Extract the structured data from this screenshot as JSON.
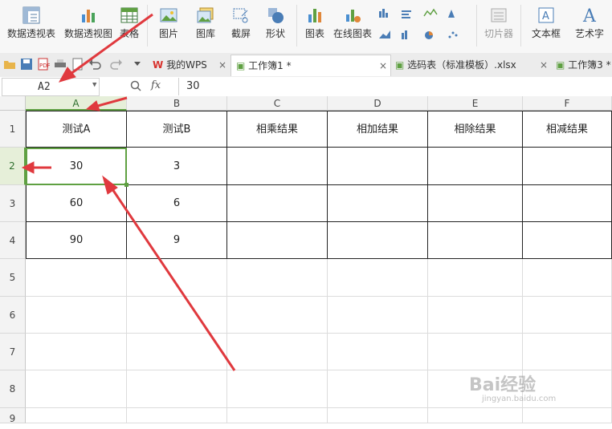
{
  "ribbon": {
    "items": [
      {
        "label": "数据透视表",
        "icon": "pivot-table-icon"
      },
      {
        "label": "数据透视图",
        "icon": "pivot-chart-icon"
      },
      {
        "label": "表格",
        "icon": "table-icon"
      },
      {
        "label": "图片",
        "icon": "picture-icon"
      },
      {
        "label": "图库",
        "icon": "gallery-icon"
      },
      {
        "label": "截屏",
        "icon": "screenshot-icon"
      },
      {
        "label": "形状",
        "icon": "shape-icon"
      },
      {
        "label": "图表",
        "icon": "chart-icon"
      },
      {
        "label": "在线图表",
        "icon": "online-chart-icon"
      },
      {
        "label": "切片器",
        "icon": "slicer-icon"
      },
      {
        "label": "文本框",
        "icon": "textbox-icon"
      },
      {
        "label": "艺术字",
        "icon": "word-art-icon"
      }
    ]
  },
  "tabs": [
    {
      "label": "我的WPS",
      "icon": "wps-logo-icon"
    },
    {
      "label": "工作簿1 *",
      "icon": "sheet-icon",
      "active": true
    },
    {
      "label": "选码表（标准模板）.xlsx",
      "icon": "sheet-icon"
    },
    {
      "label": "工作簿3 *",
      "icon": "sheet-icon"
    }
  ],
  "formula_bar": {
    "name_box": "A2",
    "fx_label": "fx",
    "value": "30"
  },
  "columns": [
    "A",
    "B",
    "C",
    "D",
    "E",
    "F"
  ],
  "rows": [
    "1",
    "2",
    "3",
    "4",
    "5",
    "6",
    "7",
    "8",
    "9"
  ],
  "cells": {
    "r1": [
      "测试A",
      "测试B",
      "相乘结果",
      "相加结果",
      "相除结果",
      "相减结果"
    ],
    "r2": [
      "30",
      "3",
      "",
      "",
      "",
      ""
    ],
    "r3": [
      "60",
      "6",
      "",
      "",
      "",
      ""
    ],
    "r4": [
      "90",
      "9",
      "",
      "",
      "",
      ""
    ]
  },
  "selected_cell": "A2",
  "accent_color": "#5fa042",
  "annotation_color": "#e0393e",
  "watermark": {
    "logo": "Bai经验",
    "url": "jingyan.baidu.com"
  }
}
